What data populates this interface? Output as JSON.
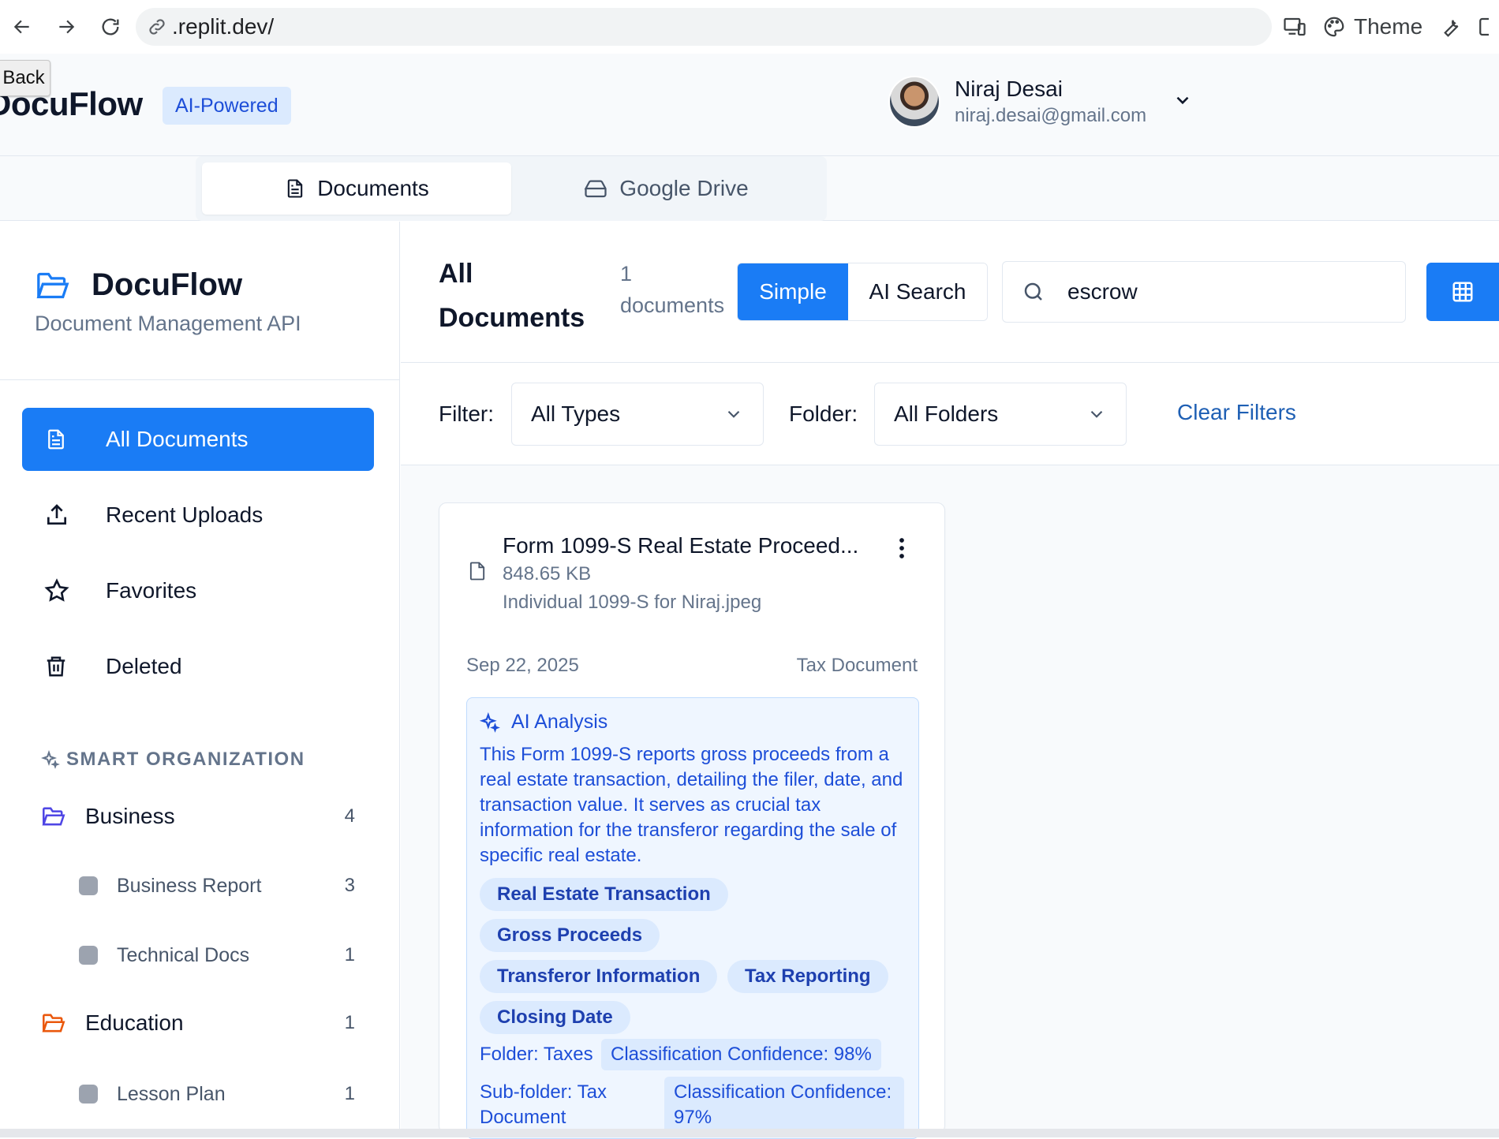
{
  "browser": {
    "url": ".replit.dev/",
    "theme_label": "Theme"
  },
  "header": {
    "back_label": "Back",
    "brand": "DocuFlow",
    "badge": "AI-Powered",
    "user": {
      "name": "Niraj Desai",
      "email": "niraj.desai@gmail.com"
    }
  },
  "tabs": [
    {
      "label": "Documents",
      "active": true
    },
    {
      "label": "Google Drive",
      "active": false
    }
  ],
  "sidebar": {
    "title": "DocuFlow",
    "subtitle": "Document Management API",
    "nav": [
      {
        "label": "All Documents",
        "icon": "document-icon",
        "active": true
      },
      {
        "label": "Recent Uploads",
        "icon": "upload-icon",
        "active": false
      },
      {
        "label": "Favorites",
        "icon": "star-icon",
        "active": false
      },
      {
        "label": "Deleted",
        "icon": "trash-icon",
        "active": false
      }
    ],
    "section_title": "SMART ORGANIZATION",
    "folders": [
      {
        "label": "Business",
        "count": "4",
        "color": "#4f46e5"
      },
      {
        "label": "Business Report",
        "count": "3"
      },
      {
        "label": "Technical Docs",
        "count": "1"
      },
      {
        "label": "Education",
        "count": "1",
        "color": "#ea580c"
      },
      {
        "label": "Lesson Plan",
        "count": "1"
      }
    ]
  },
  "main": {
    "title": "All Documents",
    "doc_count": "1 documents",
    "mode": {
      "simple": "Simple",
      "ai": "AI Search"
    },
    "search_value": "escrow",
    "filter_label": "Filter:",
    "filter_value": "All Types",
    "folder_label": "Folder:",
    "folder_value": "All Folders",
    "clear_filters": "Clear Filters"
  },
  "card": {
    "title": "Form 1099-S Real Estate Proceed...",
    "size": "848.65 KB",
    "filename": "Individual 1099-S for Niraj.jpeg",
    "date": "Sep 22, 2025",
    "type": "Tax Document",
    "ai_title": "AI Analysis",
    "summary": "This Form 1099-S reports gross proceeds from a real estate transaction, detailing the filer, date, and transaction value. It serves as crucial tax information for the transferor regarding the sale of specific real estate.",
    "tags": [
      "Real Estate Transaction",
      "Gross Proceeds",
      "Transferor Information",
      "Tax Reporting",
      "Closing Date"
    ],
    "folder": "Folder: Taxes",
    "folder_confidence": "Classification Confidence: 98%",
    "subfolder": "Sub-folder: Tax Document",
    "subfolder_confidence": "Classification Confidence: 97%"
  },
  "colors": {
    "primary": "#1a7cf5",
    "badge_bg": "#dbeafe",
    "ai_text": "#1d4ed8",
    "muted": "#64748b"
  }
}
